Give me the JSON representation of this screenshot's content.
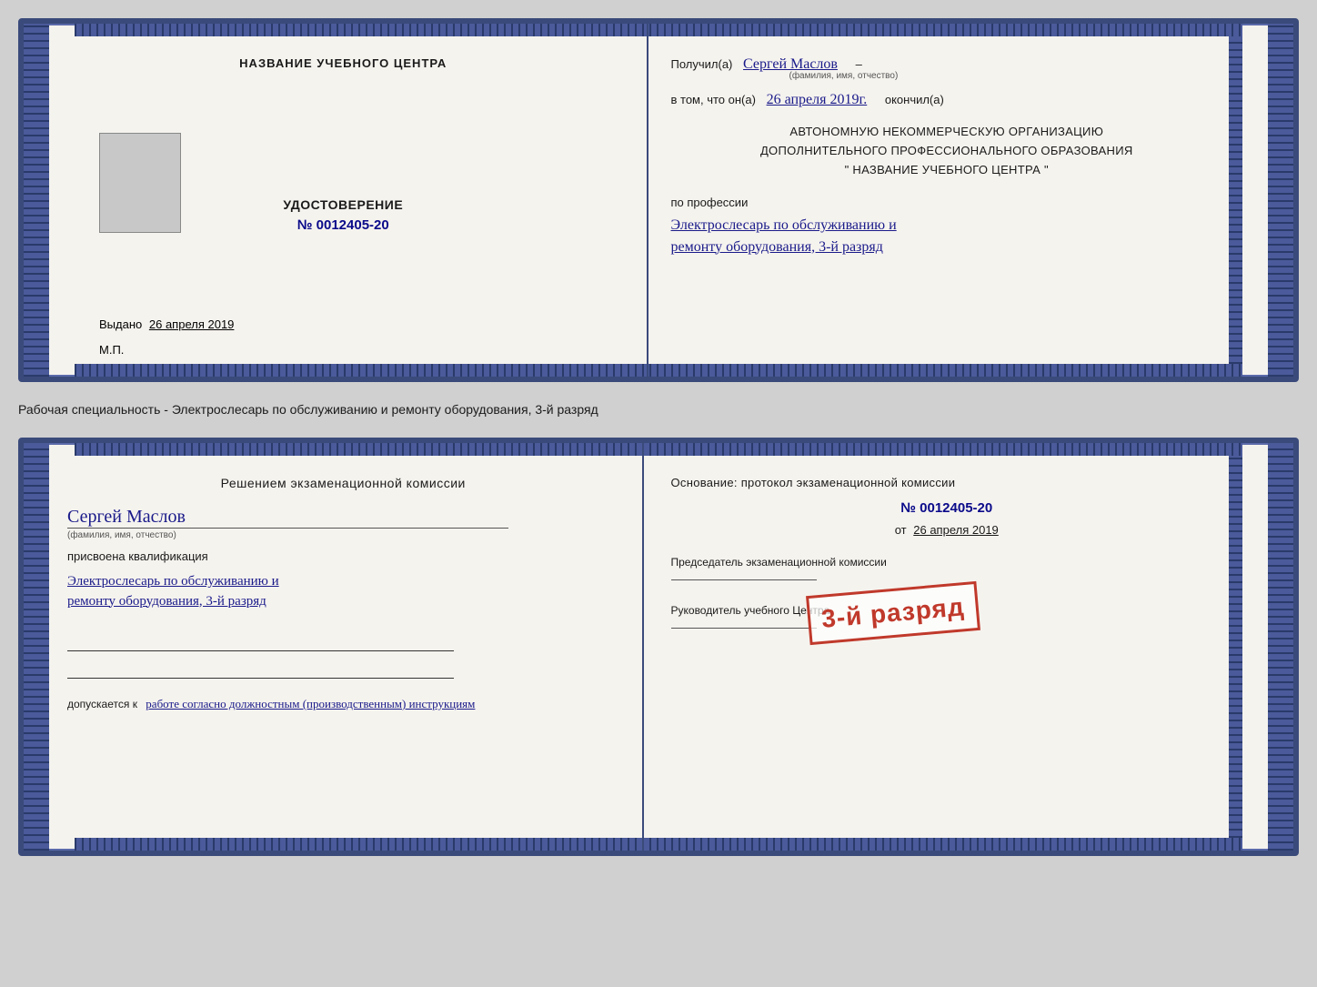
{
  "top_cert": {
    "left": {
      "school_name": "НАЗВАНИЕ УЧЕБНОГО ЦЕНТРА",
      "cert_title": "УДОСТОВЕРЕНИЕ",
      "cert_number": "№ 0012405-20",
      "issued_label": "Выдано",
      "issued_date": "26 апреля 2019",
      "mp_label": "М.П."
    },
    "right": {
      "received_prefix": "Получил(а)",
      "received_name": "Сергей Маслов",
      "fio_label": "(фамилия, имя, отчество)",
      "date_prefix": "в том, что он(а)",
      "date_value": "26 апреля 2019г.",
      "date_suffix": "окончил(а)",
      "org_line1": "АВТОНОМНУЮ НЕКОММЕРЧЕСКУЮ ОРГАНИЗАЦИЮ",
      "org_line2": "ДОПОЛНИТЕЛЬНОГО ПРОФЕССИОНАЛЬНОГО ОБРАЗОВАНИЯ",
      "org_line3": "\" НАЗВАНИЕ УЧЕБНОГО ЦЕНТРА \"",
      "profession_label": "по профессии",
      "profession_line1": "Электрослесарь по обслуживанию и",
      "profession_line2": "ремонту оборудования, 3-й разряд"
    }
  },
  "separator_text": "Рабочая специальность - Электрослесарь по обслуживанию и ремонту оборудования, 3-й разряд",
  "bottom_cert": {
    "left": {
      "decision_title": "Решением экзаменационной комиссии",
      "person_name": "Сергей Маслов",
      "fio_label": "(фамилия, имя, отчество)",
      "assigned_label": "присвоена квалификация",
      "qual_line1": "Электрослесарь по обслуживанию и",
      "qual_line2": "ремонту оборудования, 3-й разряд",
      "allowed_prefix": "допускается к",
      "allowed_value": "работе согласно должностным (производственным) инструкциям"
    },
    "right": {
      "basis_text": "Основание: протокол экзаменационной комиссии",
      "protocol_number": "№ 0012405-20",
      "date_prefix": "от",
      "date_value": "26 апреля 2019",
      "chairman_label": "Председатель экзаменационной комиссии",
      "head_label": "Руководитель учебного Центра"
    },
    "stamp": "3-й разряд"
  }
}
